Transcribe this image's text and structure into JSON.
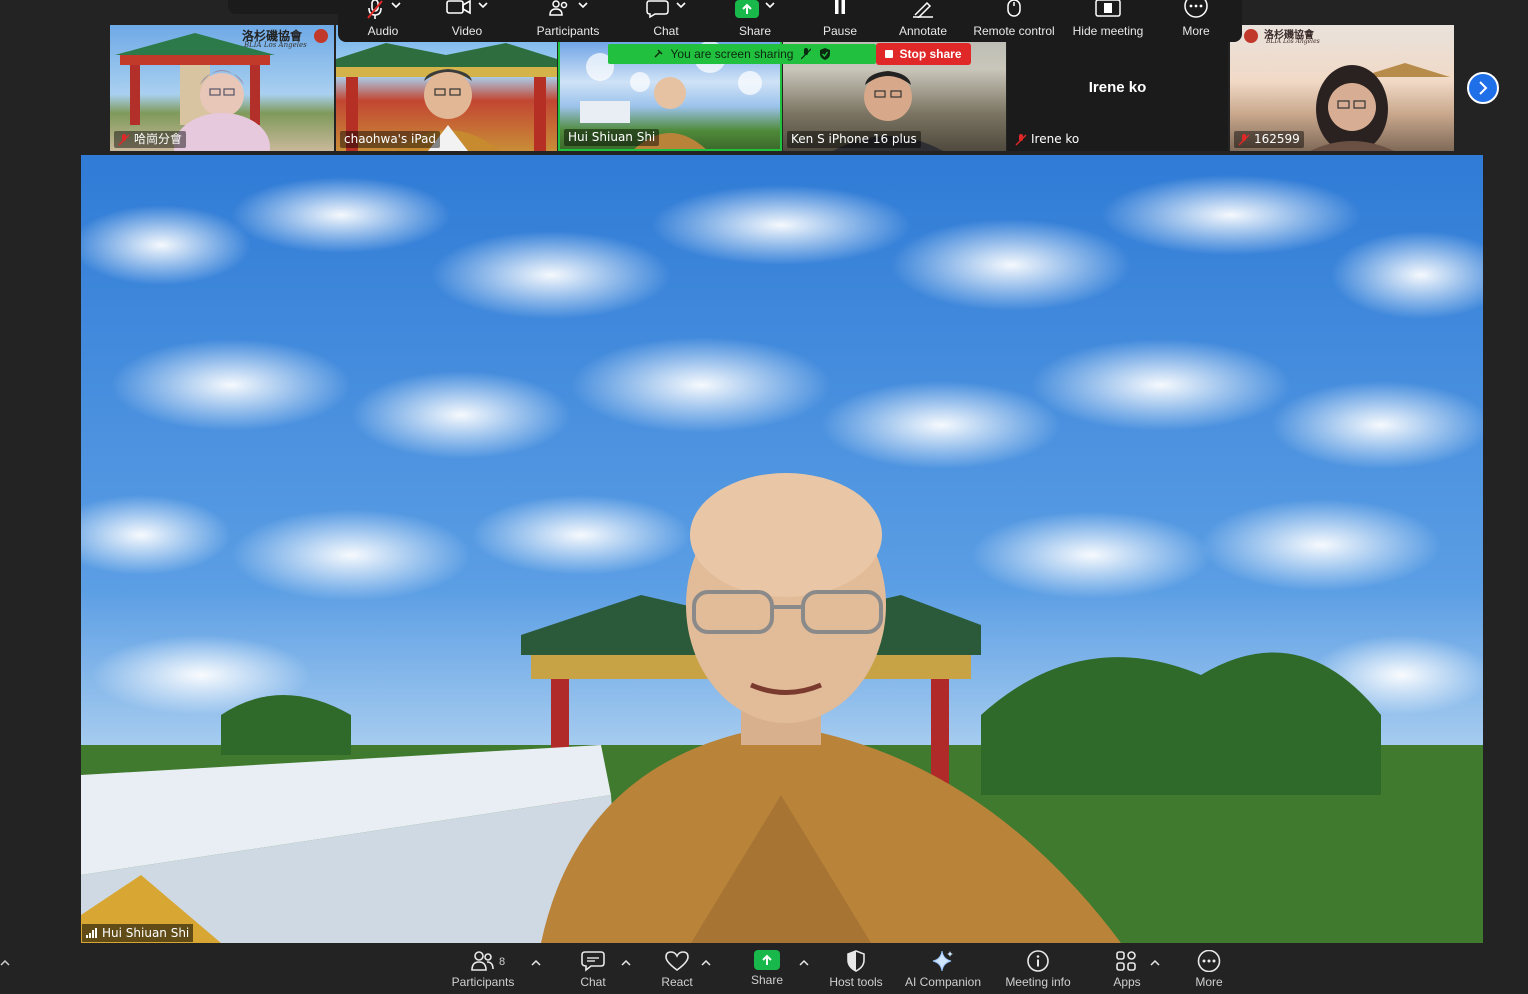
{
  "toolbar": {
    "items": [
      {
        "label": "Audio",
        "icon": "mic-muted-icon"
      },
      {
        "label": "Video",
        "icon": "video-icon"
      },
      {
        "label": "Participants",
        "icon": "participants-icon"
      },
      {
        "label": "Chat",
        "icon": "chat-icon"
      },
      {
        "label": "Share",
        "icon": "share-icon"
      },
      {
        "label": "Pause",
        "icon": "pause-icon"
      },
      {
        "label": "Annotate",
        "icon": "pen-icon"
      },
      {
        "label": "Remote control",
        "icon": "mouse-icon"
      },
      {
        "label": "Hide meeting",
        "icon": "hide-meeting-icon"
      },
      {
        "label": "More",
        "icon": "more-icon"
      }
    ]
  },
  "sharing": {
    "banner_text": "You are screen sharing",
    "stop_label": "Stop share",
    "banner_color": "#22c03f",
    "stop_color": "#e02828"
  },
  "thumbnails": [
    {
      "name": "哈崗分會",
      "muted": true,
      "logo_text": "洛杉磯協會",
      "logo_sub": "BLIA Los Angeles"
    },
    {
      "name": "chaohwa's iPad",
      "muted": false
    },
    {
      "name": "Hui Shiuan Shi",
      "muted": false,
      "active": true
    },
    {
      "name": "Ken S iPhone 16 plus",
      "muted": false
    },
    {
      "name": "Irene ko",
      "muted": true,
      "video_off": true,
      "center_name": "Irene ko"
    },
    {
      "name": "162599",
      "muted": true,
      "logo_text": "洛杉磯協會",
      "logo_sub": "BLIA Los Angeles"
    }
  ],
  "main_speaker": {
    "name": "Hui Shiuan Shi"
  },
  "bottom_toolbar": {
    "participants_count": "8",
    "items": [
      {
        "label": "Participants",
        "icon": "participants-icon"
      },
      {
        "label": "Chat",
        "icon": "chat-icon"
      },
      {
        "label": "React",
        "icon": "heart-icon"
      },
      {
        "label": "Share",
        "icon": "share-icon"
      },
      {
        "label": "Host tools",
        "icon": "shield-icon"
      },
      {
        "label": "AI Companion",
        "icon": "sparkle-icon"
      },
      {
        "label": "Meeting info",
        "icon": "info-icon"
      },
      {
        "label": "Apps",
        "icon": "apps-icon"
      },
      {
        "label": "More",
        "icon": "more-icon"
      }
    ]
  },
  "colors": {
    "accent_blue": "#1f6fe8",
    "share_green": "#18b84a",
    "background": "#232323"
  }
}
